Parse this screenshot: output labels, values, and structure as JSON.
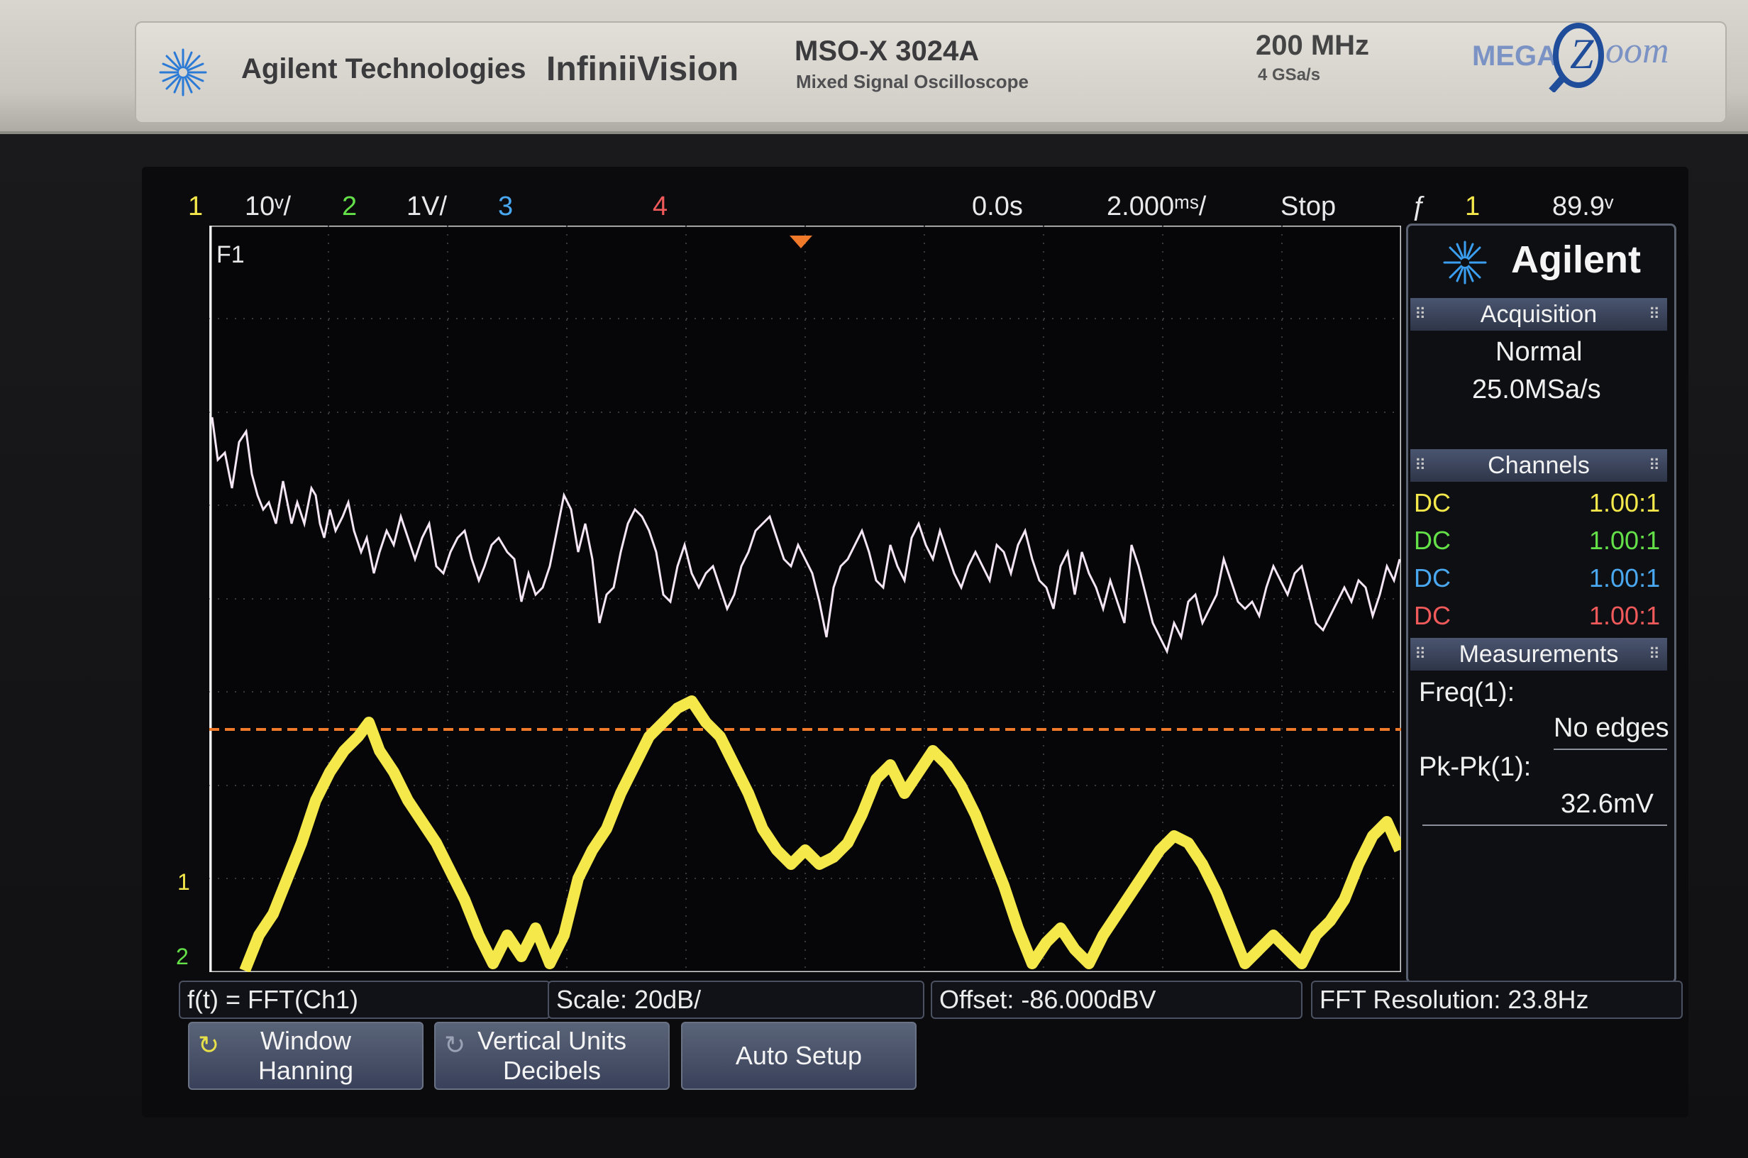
{
  "header": {
    "brand": "Agilent Technologies",
    "series": "InfiniiVision",
    "model": "MSO-X 3024A",
    "model_desc": "Mixed Signal Oscilloscope",
    "bandwidth": "200 MHz",
    "sample_rate": "4 GSa/s",
    "logo": "MEGA Zoom"
  },
  "status_bar": {
    "ch1_num": "1",
    "ch1_scale": "10ᵛ/",
    "ch2_num": "2",
    "ch2_scale": "1V/",
    "ch3_num": "3",
    "ch4_num": "4",
    "delay": "0.0s",
    "timebase": "2.000ᵐˢ/",
    "run_state": "Stop",
    "trigger_icon": "ƒ",
    "trigger_source": "1",
    "trigger_level": "89.9ᵛ"
  },
  "graticule": {
    "math_label": "F1",
    "ch1_marker": "1",
    "ch2_marker": "2"
  },
  "sidebar": {
    "logo": "Agilent",
    "acquisition_title": "Acquisition",
    "acq_mode": "Normal",
    "acq_rate": "25.0MSa/s",
    "channels_title": "Channels",
    "channels": [
      {
        "coupling": "DC",
        "probe": "1.00:1",
        "color": "#f4e84a"
      },
      {
        "coupling": "DC",
        "probe": "1.00:1",
        "color": "#64e049"
      },
      {
        "coupling": "DC",
        "probe": "1.00:1",
        "color": "#4aa8f0"
      },
      {
        "coupling": "DC",
        "probe": "1.00:1",
        "color": "#f05a5a"
      }
    ],
    "measurements_title": "Measurements",
    "freq_label": "Freq(1):",
    "freq_value": "No edges",
    "pkpk_label": "Pk-Pk(1):",
    "pkpk_value": "32.6mV"
  },
  "info_bar": {
    "function": "f(t) = FFT(Ch1)",
    "scale": "Scale: 20dB/",
    "offset": "Offset: -86.000dBV",
    "resolution": "FFT Resolution: 23.8Hz"
  },
  "softkeys": {
    "window_l1": "Window",
    "window_l2": "Hanning",
    "units_l1": "Vertical Units",
    "units_l2": "Decibels",
    "auto": "Auto Setup"
  },
  "colors": {
    "ch1": "#f4e84a",
    "ch2": "#64e049",
    "ch3": "#4aa8f0",
    "ch4": "#f05a5a",
    "math": "#f2e6f2",
    "trigger": "#f07a2a"
  }
}
